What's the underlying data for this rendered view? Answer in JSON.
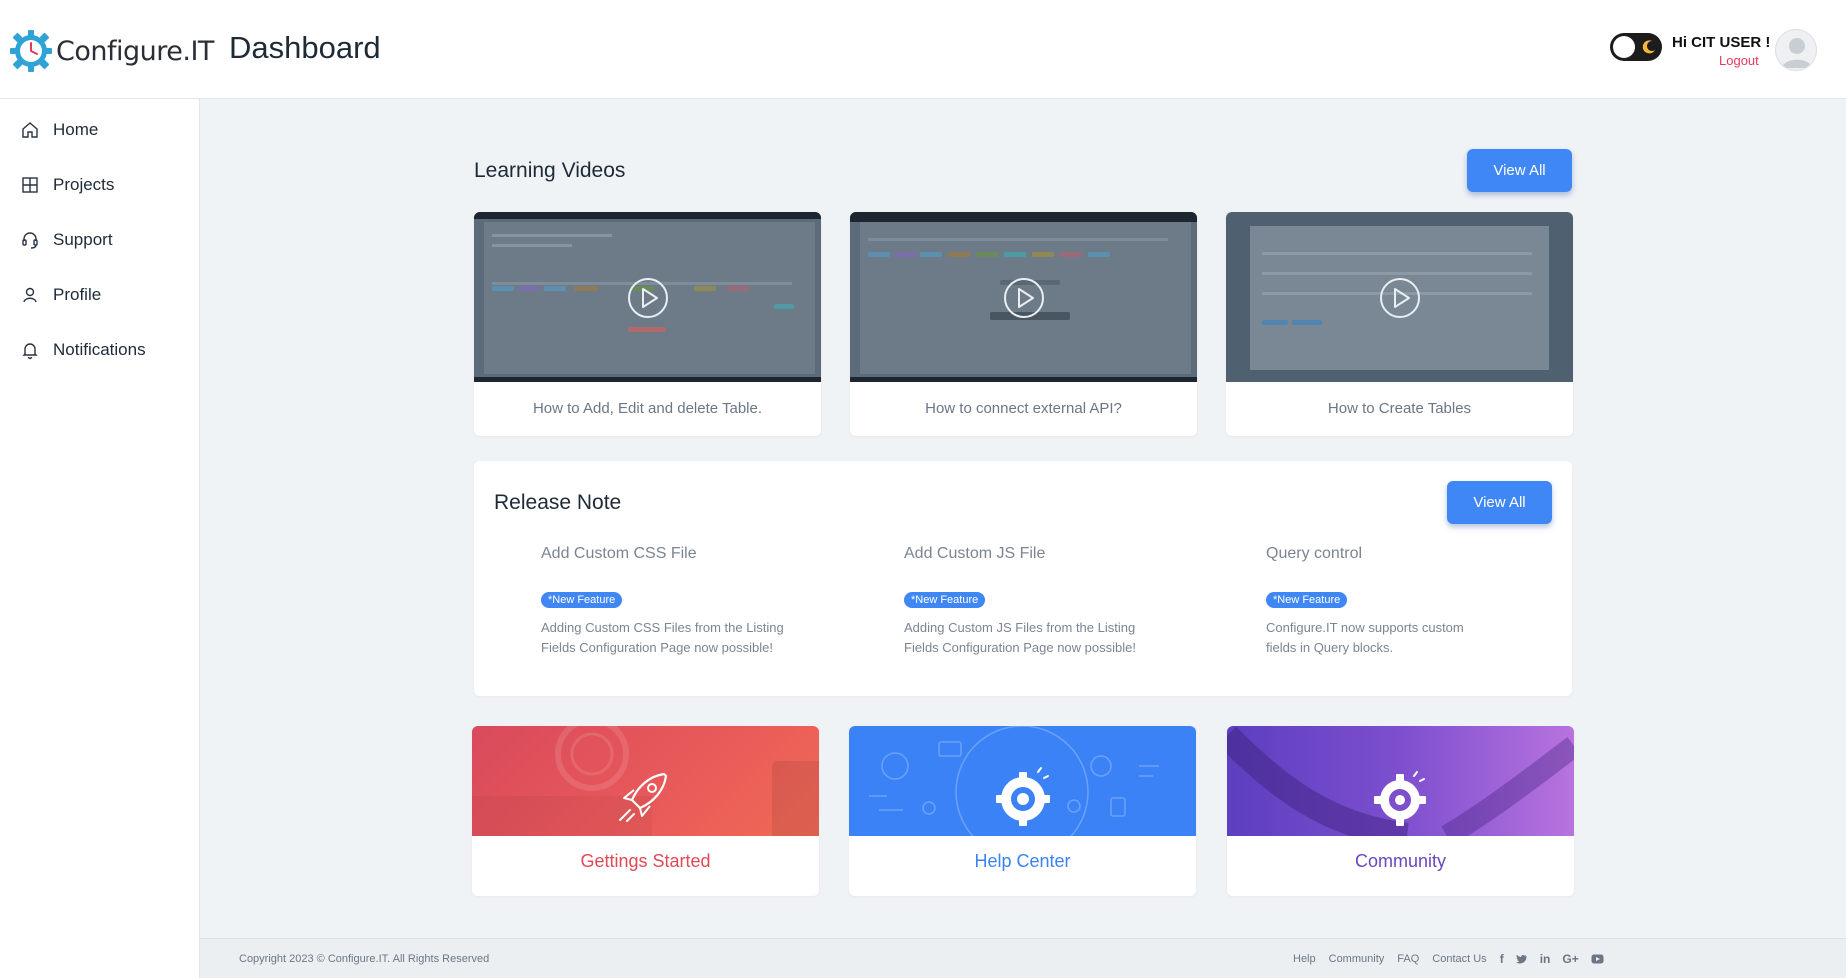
{
  "header": {
    "logo_text": "Configure.IT",
    "title": "Dashboard",
    "greeting": "Hi CIT USER !",
    "logout": "Logout"
  },
  "sidebar": {
    "items": [
      {
        "label": "Home",
        "icon": "home-icon"
      },
      {
        "label": "Projects",
        "icon": "grid-icon"
      },
      {
        "label": "Support",
        "icon": "headset-icon"
      },
      {
        "label": "Profile",
        "icon": "user-icon"
      },
      {
        "label": "Notifications",
        "icon": "bell-icon"
      }
    ]
  },
  "learning": {
    "title": "Learning Videos",
    "view_all": "View All",
    "videos": [
      {
        "caption": "How to Add, Edit and delete Table."
      },
      {
        "caption": "How to connect external API?"
      },
      {
        "caption": "How to Create Tables"
      }
    ]
  },
  "release": {
    "title": "Release Note",
    "view_all": "View All",
    "notes": [
      {
        "title": "Add Custom CSS File",
        "badge": "*New Feature",
        "desc": "Adding Custom CSS Files from the Listing Fields Configuration Page now possible!"
      },
      {
        "title": "Add Custom JS File",
        "badge": "*New Feature",
        "desc": "Adding Custom JS Files from the Listing Fields Configuration Page now possible!"
      },
      {
        "title": "Query control",
        "badge": "*New Feature",
        "desc": "Configure.IT now supports custom fields in Query blocks."
      }
    ]
  },
  "tiles": [
    {
      "label": "Gettings Started",
      "color": "#e04a55"
    },
    {
      "label": "Help Center",
      "color": "#3b82f6"
    },
    {
      "label": "Community",
      "color": "#6b46c1"
    }
  ],
  "footer": {
    "copyright": "Copyright 2023 © Configure.IT. All Rights Reserved",
    "links": [
      "Help",
      "Community",
      "FAQ",
      "Contact Us"
    ],
    "social": [
      "facebook-icon",
      "twitter-icon",
      "linkedin-icon",
      "google-plus-icon",
      "youtube-icon"
    ]
  },
  "colors": {
    "accent": "#3f87f5",
    "logout": "#e33c5b"
  }
}
